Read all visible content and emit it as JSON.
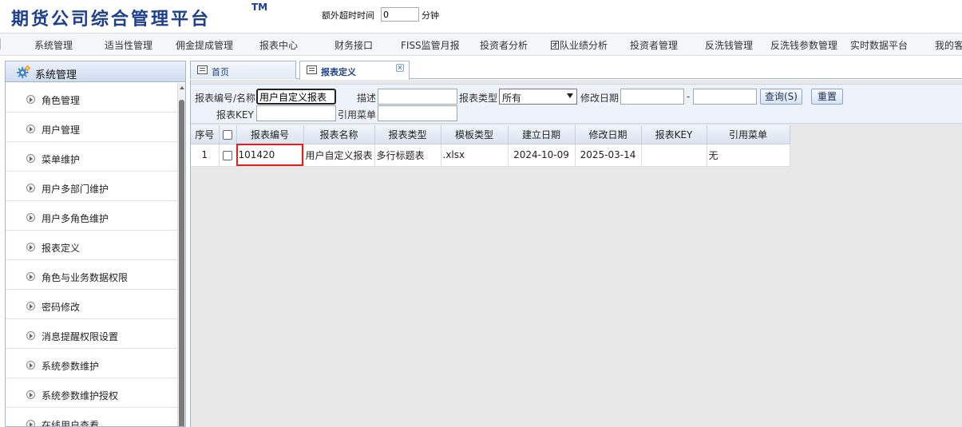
{
  "header": {
    "logo_text": "期货公司综合管理平台",
    "logo_tm": "TM",
    "timeout_label": "额外超时时间",
    "timeout_value": "0",
    "timeout_unit": "分钟"
  },
  "nav": {
    "items": [
      "系统管理",
      "适当性管理",
      "佣金提成管理",
      "报表中心",
      "财务接口",
      "FISS监管月报",
      "投资者分析",
      "团队业绩分析",
      "投资者管理",
      "反洗钱管理",
      "反洗钱参数管理",
      "实时数据平台",
      "我的客"
    ]
  },
  "sidebar": {
    "title": "系统管理",
    "items": [
      "角色管理",
      "用户管理",
      "菜单维护",
      "用户多部门维护",
      "用户多角色维护",
      "报表定义",
      "角色与业务数据权限",
      "密码修改",
      "消息提醒权限设置",
      "系统参数维护",
      "系统参数维护授权",
      "在线用户查看"
    ]
  },
  "tabs": [
    {
      "label": "首页",
      "active": false
    },
    {
      "label": "报表定义",
      "active": true,
      "close": "×"
    }
  ],
  "search": {
    "code_label": "报表编号/名称",
    "code_value": "用户自定义报表",
    "desc_label": "描述",
    "desc_value": "",
    "type_label": "报表类型",
    "type_value": "所有",
    "modified_label": "修改日期",
    "date_from": "",
    "date_sep": "-",
    "date_to": "",
    "query_button": "查询(S)",
    "reset_button": "重置",
    "key_label": "报表KEY",
    "key_value": "",
    "menu_label": "引用菜单",
    "menu_value": ""
  },
  "table": {
    "columns": [
      "序号",
      "",
      "报表编号",
      "报表名称",
      "报表类型",
      "模板类型",
      "建立日期",
      "修改日期",
      "报表KEY",
      "引用菜单"
    ],
    "rows": [
      {
        "no": "1",
        "code": "101420",
        "name": "用户自定义报表",
        "type": "多行标题表",
        "template": ".xlsx",
        "created": "2024-10-09",
        "modified": "2025-03-14",
        "key": "",
        "menu": "无"
      }
    ]
  },
  "colors": {
    "brand": "#1d3f8f",
    "border": "#9fb6d6",
    "highlight": "#e01e1e"
  }
}
